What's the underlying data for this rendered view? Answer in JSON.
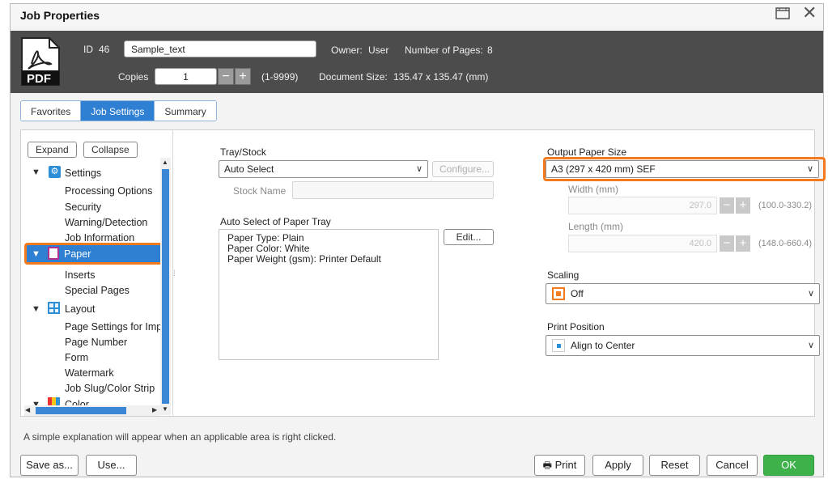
{
  "window": {
    "title": "Job Properties"
  },
  "header": {
    "icon_label": "PDF",
    "id_label": "ID",
    "id_value": "46",
    "job_name": "Sample_text",
    "owner_label": "Owner:",
    "owner_value": "User",
    "pages_label": "Number of Pages:",
    "pages_value": "8",
    "copies_label": "Copies",
    "copies_value": "1",
    "copies_range": "(1-9999)",
    "doc_size_label": "Document Size:",
    "doc_size_value": "135.47 x 135.47 (mm)"
  },
  "tabs": [
    {
      "label": "Favorites"
    },
    {
      "label": "Job Settings"
    },
    {
      "label": "Summary"
    }
  ],
  "tree": {
    "expand_label": "Expand",
    "collapse_label": "Collapse",
    "settings": "Settings",
    "settings_children": [
      "Processing Options",
      "Security",
      "Warning/Detection",
      "Job Information"
    ],
    "paper": "Paper",
    "paper_children": [
      "Inserts",
      "Special Pages"
    ],
    "layout": "Layout",
    "layout_children": [
      "Page Settings for Imposition",
      "Page Number",
      "Form",
      "Watermark",
      "Job Slug/Color Strip"
    ],
    "color": "Color"
  },
  "tray": {
    "label": "Tray/Stock",
    "value": "Auto Select",
    "configure_label": "Configure...",
    "stock_name_label": "Stock Name",
    "auto_select_label": "Auto Select of Paper Tray",
    "details": [
      "Paper Type: Plain",
      "Paper Color: White",
      "Paper Weight (gsm): Printer Default"
    ],
    "edit_label": "Edit..."
  },
  "output": {
    "label": "Output Paper Size",
    "value": "A3 (297 x 420 mm) SEF",
    "width_label": "Width (mm)",
    "width_value": "297.0",
    "width_range": "(100.0-330.2)",
    "length_label": "Length (mm)",
    "length_value": "420.0",
    "length_range": "(148.0-660.4)",
    "scaling_label": "Scaling",
    "scaling_value": "Off",
    "position_label": "Print Position",
    "position_value": "Align to Center"
  },
  "status_text": "A simple explanation will appear when an applicable area is right clicked.",
  "buttons": {
    "save_as": "Save as...",
    "use": "Use...",
    "print": "Print",
    "apply": "Apply",
    "reset": "Reset",
    "cancel": "Cancel",
    "ok": "OK"
  },
  "colors": {
    "accent": "#2f7fd3",
    "highlight": "#f47a1e",
    "ok": "#3fb14b",
    "header_bg": "#4c4c4c"
  }
}
